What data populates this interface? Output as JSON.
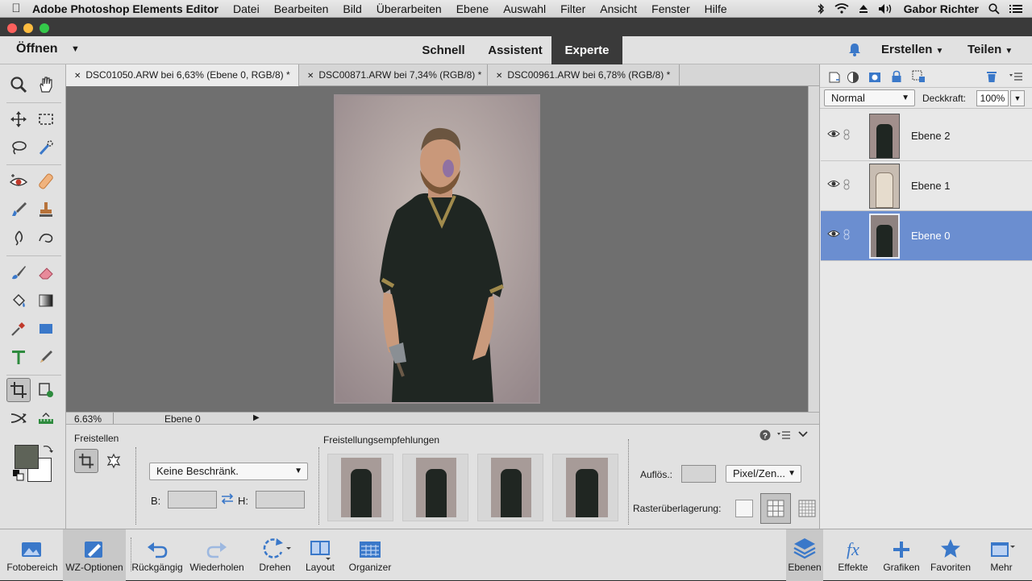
{
  "menubar": {
    "app_name": "Adobe Photoshop Elements Editor",
    "items": [
      "Datei",
      "Bearbeiten",
      "Bild",
      "Überarbeiten",
      "Ebene",
      "Auswahl",
      "Filter",
      "Ansicht",
      "Fenster",
      "Hilfe"
    ],
    "user": "Gabor Richter"
  },
  "appbar": {
    "open_label": "Öffnen",
    "modes": [
      "Schnell",
      "Assistent",
      "Experte"
    ],
    "active_mode": "Experte",
    "create_label": "Erstellen",
    "share_label": "Teilen"
  },
  "doc_tabs": [
    {
      "label": "DSC01050.ARW bei 6,63% (Ebene 0, RGB/8) *",
      "active": true
    },
    {
      "label": "DSC00871.ARW bei 7,34% (RGB/8) *",
      "active": false
    },
    {
      "label": "DSC00961.ARW bei 6,78% (RGB/8) *",
      "active": false
    }
  ],
  "status": {
    "zoom": "6.63%",
    "layer": "Ebene 0"
  },
  "tool_options": {
    "section_title": "Freistellen",
    "constraint_value": "Keine Beschränk.",
    "width_label": "B:",
    "height_label": "H:",
    "suggestions_title": "Freistellungsempfehlungen",
    "resolution_label": "Auflös.:",
    "unit_value": "Pixel/Zen...",
    "grid_overlay_label": "Rasterüberlagerung:"
  },
  "layers_panel": {
    "blend_mode": "Normal",
    "opacity_label": "Deckkraft:",
    "opacity_value": "100%",
    "layers": [
      {
        "name": "Ebene 2",
        "selected": false
      },
      {
        "name": "Ebene 1",
        "selected": false
      },
      {
        "name": "Ebene 0",
        "selected": true
      }
    ]
  },
  "bottom_bar": {
    "left": [
      {
        "label": "Fotobereich",
        "icon": "photo-bin-icon"
      },
      {
        "label": "WZ-Optionen",
        "icon": "tool-options-icon"
      },
      {
        "label": "Rückgängig",
        "icon": "undo-icon"
      },
      {
        "label": "Wiederholen",
        "icon": "redo-icon"
      },
      {
        "label": "Drehen",
        "icon": "rotate-icon"
      },
      {
        "label": "Layout",
        "icon": "layout-icon"
      },
      {
        "label": "Organizer",
        "icon": "organizer-icon"
      }
    ],
    "right": [
      {
        "label": "Ebenen",
        "icon": "layers-icon"
      },
      {
        "label": "Effekte",
        "icon": "fx-icon"
      },
      {
        "label": "Grafiken",
        "icon": "plus-icon"
      },
      {
        "label": "Favoriten",
        "icon": "star-icon"
      },
      {
        "label": "Mehr",
        "icon": "more-icon"
      }
    ]
  },
  "colors": {
    "accent_blue": "#3a78c9",
    "selected_layer": "#6b8ed0",
    "foreground_swatch": "#5e6358"
  }
}
